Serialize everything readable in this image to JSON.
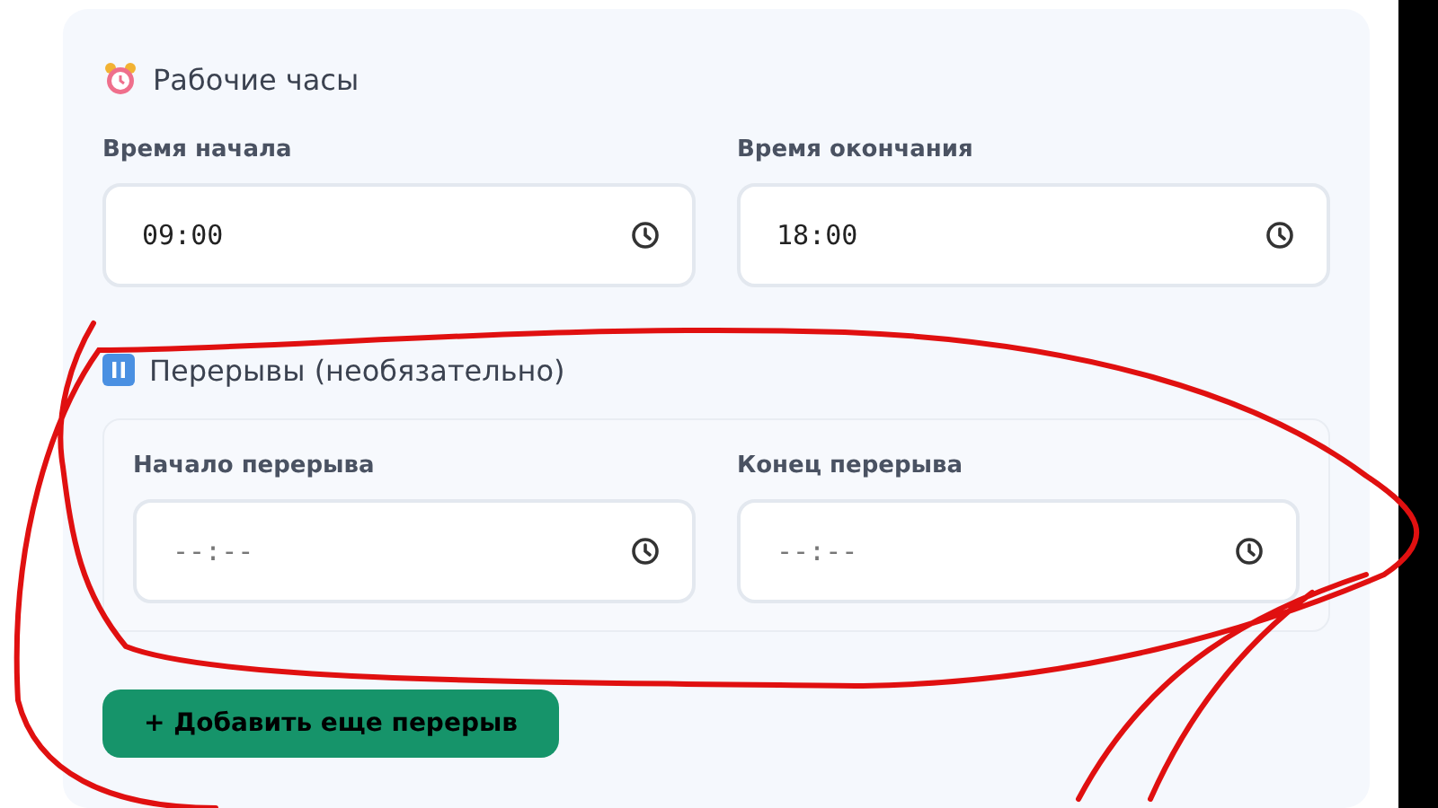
{
  "work_hours": {
    "title": "Рабочие часы",
    "fields": [
      {
        "label": "Время начала",
        "value": "09:00"
      },
      {
        "label": "Время окончания",
        "value": "18:00"
      }
    ]
  },
  "breaks": {
    "title": "Перерывы (необязательно)",
    "fields": [
      {
        "label": "Начало перерыва",
        "placeholder": "--:--"
      },
      {
        "label": "Конец перерыва",
        "placeholder": "--:--"
      }
    ]
  },
  "add_button": "+ Добавить еще перерыв"
}
